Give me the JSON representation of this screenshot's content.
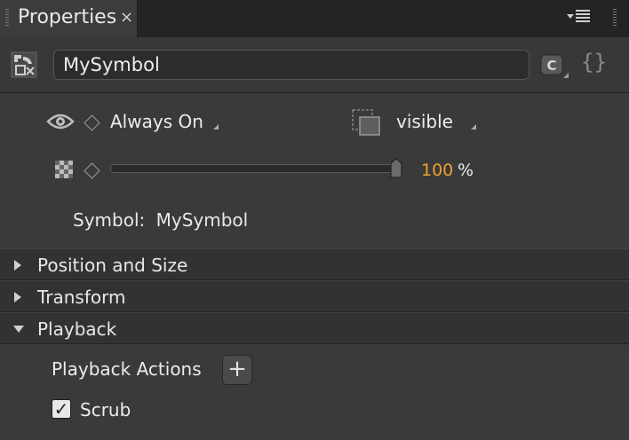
{
  "tab": {
    "title": "Properties",
    "close_glyph": "×"
  },
  "symbol": {
    "name": "MySymbol",
    "class_button": "C",
    "code_button": "{}"
  },
  "display": {
    "value": "Always On",
    "overflow_value": "visible"
  },
  "opacity": {
    "value": 100,
    "value_text": "100",
    "unit": "%"
  },
  "symbol_info": {
    "label": "Symbol:",
    "name": "MySymbol"
  },
  "sections": [
    {
      "title": "Position and Size",
      "expanded": false
    },
    {
      "title": "Transform",
      "expanded": false
    },
    {
      "title": "Playback",
      "expanded": true
    }
  ],
  "playback": {
    "actions_label": "Playback Actions",
    "add_glyph": "+",
    "scrub_label": "Scrub",
    "scrub_checked": true
  },
  "colors": {
    "accent": "#f0a030",
    "panel_bg": "#3a3a3a",
    "header_bg": "#323232"
  },
  "icons": [
    "panel-menu-icon",
    "symbol-icon",
    "class-icon",
    "code-icon",
    "eye-icon",
    "keyframe-diamond-icon",
    "overflow-visible-icon",
    "opacity-checker-icon",
    "disclosure-arrow-icon",
    "plus-icon",
    "checkmark-icon"
  ]
}
